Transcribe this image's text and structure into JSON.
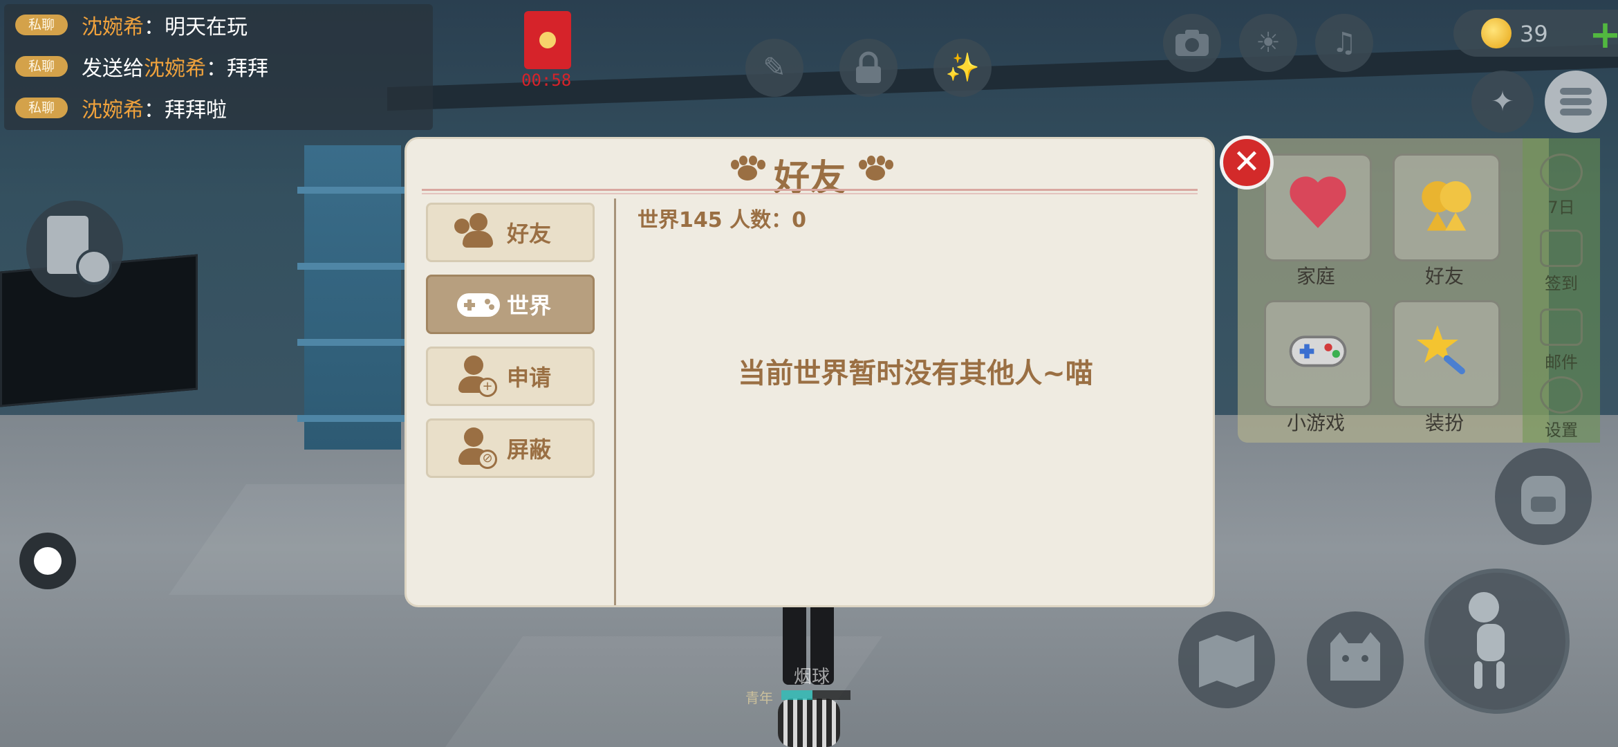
{
  "chat": [
    {
      "tag": "私聊",
      "name": "沈婉希",
      "sep": "：",
      "text": "明天在玩"
    },
    {
      "tag": "私聊",
      "prefix": "发送给",
      "name": "沈婉希",
      "sep": "：",
      "text": "拜拜"
    },
    {
      "tag": "私聊",
      "name": "沈婉希",
      "sep": "：",
      "text": "拜拜啦"
    }
  ],
  "red_packet": {
    "timer": "00:58"
  },
  "coins": {
    "value": "39",
    "plus": "+"
  },
  "top_icons": [
    "brush-icon",
    "lock-icon",
    "fireworks-icon",
    "camera-icon",
    "sun-icon",
    "music-icon"
  ],
  "side_panel": {
    "tiles": [
      {
        "label": "家庭",
        "icon": "heart-icon"
      },
      {
        "label": "好友",
        "icon": "friends-icon"
      },
      {
        "label": "小游戏",
        "icon": "gamepad-icon"
      },
      {
        "label": "装扮",
        "icon": "magic-wand-icon"
      }
    ],
    "strip": [
      {
        "label": "7日",
        "icon": "seven-day-icon"
      },
      {
        "label": "签到",
        "icon": "checkin-icon"
      },
      {
        "label": "邮件",
        "icon": "mail-icon"
      },
      {
        "label": "设置",
        "icon": "settings-icon"
      }
    ]
  },
  "player": {
    "name": "烟球",
    "rank": "青年",
    "level_fraction": 0.45
  },
  "dialog": {
    "title": "好友",
    "close": "✕",
    "tabs": [
      {
        "label": "好友",
        "icon": "friends-icon",
        "active": false
      },
      {
        "label": "世界",
        "icon": "gamepad-icon",
        "active": true
      },
      {
        "label": "申请",
        "icon": "add-friend-icon",
        "active": false
      },
      {
        "label": "屏蔽",
        "icon": "block-user-icon",
        "active": false
      }
    ],
    "world_info": "世界145  人数：0",
    "empty_message": "当前世界暂时没有其他人~喵"
  },
  "colors": {
    "accent_brown": "#9a6f43",
    "dialog_bg": "#efebe1",
    "close_red": "#d32a2a",
    "chat_name": "#f0a23c"
  }
}
